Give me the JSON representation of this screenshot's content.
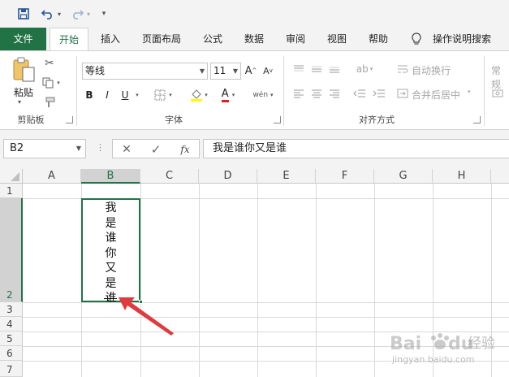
{
  "qat": {
    "save_icon": "save-icon",
    "undo_icon": "undo-icon",
    "redo_icon": "redo-icon",
    "customize_icon": "customize-icon"
  },
  "tabs": [
    {
      "label": "文件"
    },
    {
      "label": "开始"
    },
    {
      "label": "插入"
    },
    {
      "label": "页面布局"
    },
    {
      "label": "公式"
    },
    {
      "label": "数据"
    },
    {
      "label": "审阅"
    },
    {
      "label": "视图"
    },
    {
      "label": "帮助"
    },
    {
      "label": "操作说明搜索"
    }
  ],
  "ribbon": {
    "clipboard": {
      "paste_label": "粘贴",
      "group_label": "剪贴板"
    },
    "font": {
      "font_name": "等线",
      "font_size": "11",
      "bold": "B",
      "italic": "I",
      "underline": "U",
      "group_label": "字体"
    },
    "alignment": {
      "wrap_text": "自动换行",
      "merge_center": "合并后居中",
      "group_label": "对齐方式"
    },
    "number": {
      "format_label": "常规"
    }
  },
  "formula_bar": {
    "name_box": "B2",
    "content": "我是谁你又是谁"
  },
  "columns": [
    "A",
    "B",
    "C",
    "D",
    "E",
    "F",
    "G",
    "H"
  ],
  "rows": [
    "1",
    "2",
    "3",
    "4",
    "5",
    "6",
    "7"
  ],
  "cell_b2_chars": [
    "我",
    "是",
    "谁",
    "你",
    "又",
    "是",
    "谁"
  ],
  "colors": {
    "excel_green": "#217346",
    "arrow_red": "#e0393e"
  },
  "watermark": {
    "brand": "Baidu",
    "cn": "经验",
    "url": "jingyan.baidu.com"
  }
}
